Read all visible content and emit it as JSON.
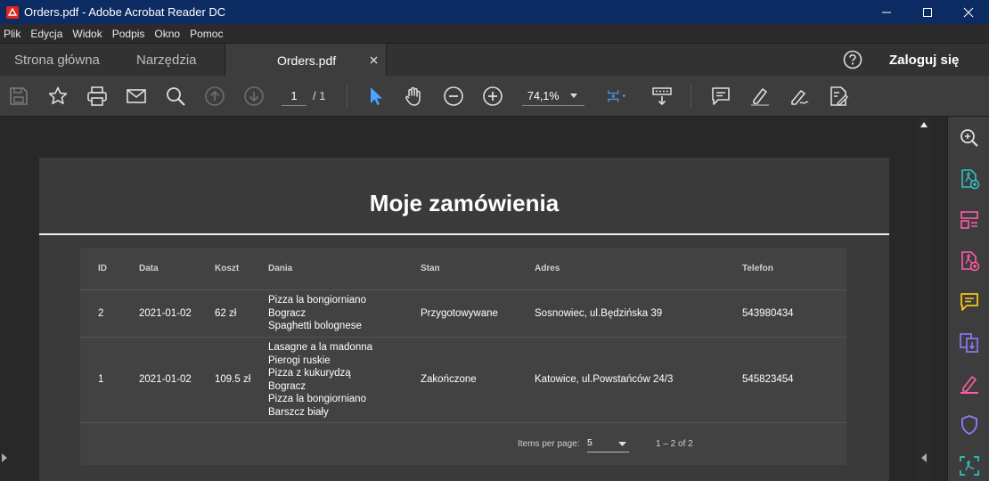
{
  "window": {
    "title": "Orders.pdf - Adobe Acrobat Reader DC"
  },
  "menu": [
    "Plik",
    "Edycja",
    "Widok",
    "Podpis",
    "Okno",
    "Pomoc"
  ],
  "tabs": {
    "home": "Strona główna",
    "tools": "Narzędzia",
    "document": "Orders.pdf",
    "sign_in": "Zaloguj się"
  },
  "toolbar": {
    "current_page": "1",
    "page_separator": "/ 1",
    "zoom": "74,1%"
  },
  "document": {
    "title": "Moje zamówienia",
    "columns": [
      "ID",
      "Data",
      "Koszt",
      "Dania",
      "Stan",
      "Adres",
      "Telefon"
    ],
    "rows": [
      {
        "id": "2",
        "date": "2021-01-02",
        "cost": "62 zł",
        "dishes": [
          "Pizza la bongiorniano",
          "Bogracz",
          "Spaghetti bolognese"
        ],
        "status": "Przygotowywane",
        "address": "Sosnowiec, ul.Będzińska 39",
        "phone": "543980434"
      },
      {
        "id": "1",
        "date": "2021-01-02",
        "cost": "109.5 zł",
        "dishes": [
          "Lasagne a la madonna",
          "Pierogi ruskie",
          "Pizza z kukurydzą",
          "Bogracz",
          "Pizza la bongiorniano",
          "Barszcz biały"
        ],
        "status": "Zakończone",
        "address": "Katowice, ul.Powstańców 24/3",
        "phone": "545823454"
      }
    ],
    "paginator": {
      "items_per_page_label": "Items per page:",
      "page_size": "5",
      "range": "1 – 2 of 2"
    }
  },
  "colors": {
    "titlebar": "#0c2b62",
    "accent_blue": "#4aa3ff",
    "teal": "#2cc3c3",
    "pink": "#ff5ea8",
    "yellow": "#f5c518",
    "purple": "#8f7cff"
  }
}
